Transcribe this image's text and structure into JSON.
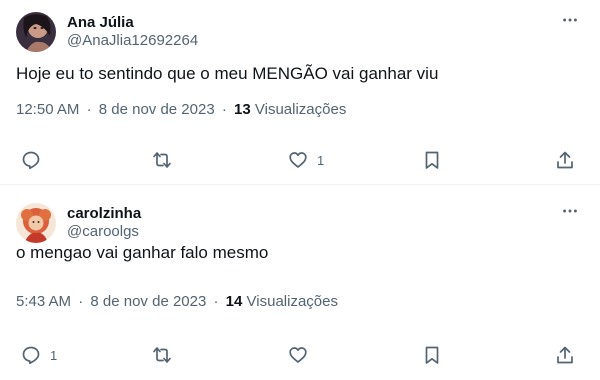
{
  "tweets": [
    {
      "display_name": "Ana Júlia",
      "handle": "@AnaJlia12692264",
      "text": "Hoje eu to sentindo que o meu MENGÃO vai ganhar viu",
      "time": "12:50 AM",
      "date": "8 de nov de 2023",
      "separator": "·",
      "views_count": "13",
      "views_label": "Visualizações",
      "reply_count": "",
      "retweet_count": "",
      "like_count": "1"
    },
    {
      "display_name": "carolzinha",
      "handle": "@caroolgs",
      "text": "o mengao vai ganhar falo mesmo",
      "time": "5:43 AM",
      "date": "8 de nov de 2023",
      "separator": "·",
      "views_count": "14",
      "views_label": "Visualizações",
      "reply_count": "1",
      "retweet_count": "",
      "like_count": ""
    }
  ],
  "icons": {
    "more": "more-horizontal-icon",
    "reply": "reply-icon",
    "retweet": "retweet-icon",
    "like": "heart-icon",
    "bookmark": "bookmark-icon",
    "share": "share-icon"
  },
  "colors": {
    "text_primary": "#0f1419",
    "text_secondary": "#536471",
    "divider": "#eff3f4"
  }
}
